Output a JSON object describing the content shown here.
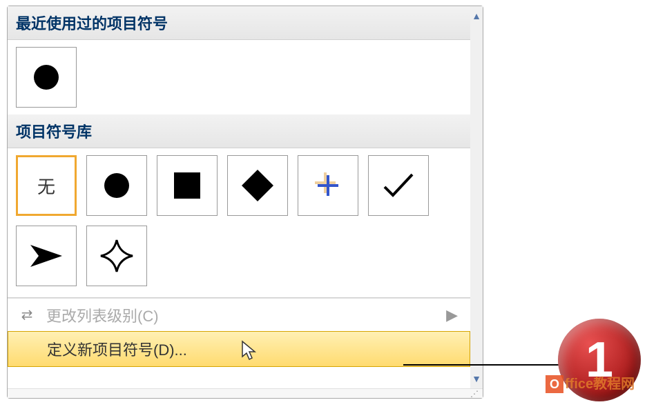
{
  "sections": {
    "recent_header": "最近使用过的项目符号",
    "library_header": "项目符号库"
  },
  "recent_bullets": [
    {
      "name": "filled-circle"
    }
  ],
  "library_bullets": [
    {
      "name": "none",
      "label": "无",
      "selected": true
    },
    {
      "name": "filled-circle"
    },
    {
      "name": "filled-square"
    },
    {
      "name": "filled-diamond"
    },
    {
      "name": "plus-cross"
    },
    {
      "name": "checkmark"
    },
    {
      "name": "arrowhead"
    },
    {
      "name": "four-point-star"
    }
  ],
  "menu": {
    "change_level": "更改列表级别(C)",
    "define_new": "定义新项目符号(D)..."
  },
  "callout": {
    "number": "1"
  },
  "watermark": {
    "text": "ffice教程网"
  }
}
